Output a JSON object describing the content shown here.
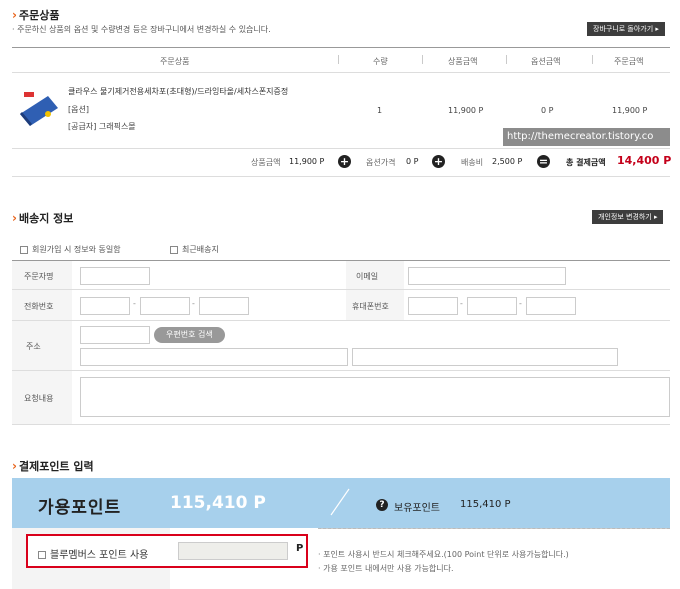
{
  "order": {
    "title": "주문상품",
    "subtitle": "· 주문하신 상품의 옵션 및 수량변경 등은 장바구니에서 변경하실 수 있습니다.",
    "cart_button": "장바구니로 돌아가기 ▸",
    "headers": [
      "주문상품",
      "수량",
      "상품금액",
      "옵션금액",
      "주문금액"
    ],
    "item": {
      "name": "클라우스 물기제거전용세차포(초대형)/드라잉타올/세차스폰지증정",
      "option": "[옵션]",
      "supplier": "[공급자] 그래픽스몰",
      "qty": "1",
      "price": "11,900 P",
      "option_price": "0 P",
      "order_price": "11,900 P"
    },
    "watermark": "http://themecreator.tistory.co",
    "summary": {
      "product_label": "상품금액",
      "product_value": "11,900 P",
      "option_label": "옵션가격",
      "option_value": "0 P",
      "shipping_label": "배송비",
      "shipping_value": "2,500 P",
      "total_label": "총 결제금액",
      "total_value": "14,400 P",
      "plus": "+",
      "equals": "="
    }
  },
  "shipping": {
    "title": "배송지 정보",
    "info_button": "개인정보 변경하기 ▸",
    "same_as_member": "회원가입 시 정보와 동일함",
    "recent_address": "최근배송지",
    "orderer": "주문자명",
    "email": "이메일",
    "phone": "전화번호",
    "mobile": "휴대폰번호",
    "address": "주소",
    "zip_button": "우편번호 검색",
    "request": "요청내용",
    "dash": "-"
  },
  "points": {
    "title": "결제포인트 입력",
    "available_label": "가용포인트",
    "available_value": "115,410 P",
    "owned_label": "보유포인트",
    "owned_value": "115,410 P",
    "help_glyph": "?",
    "use_label": "블루멤버스 포인트 사용",
    "unit": "P",
    "note1": "· 포인트 사용시 반드시 체크해주세요.(100 Point 단위로 사용가능합니다.)",
    "note2": "· 가용 포인트 내에서만 사용 가능합니다."
  }
}
